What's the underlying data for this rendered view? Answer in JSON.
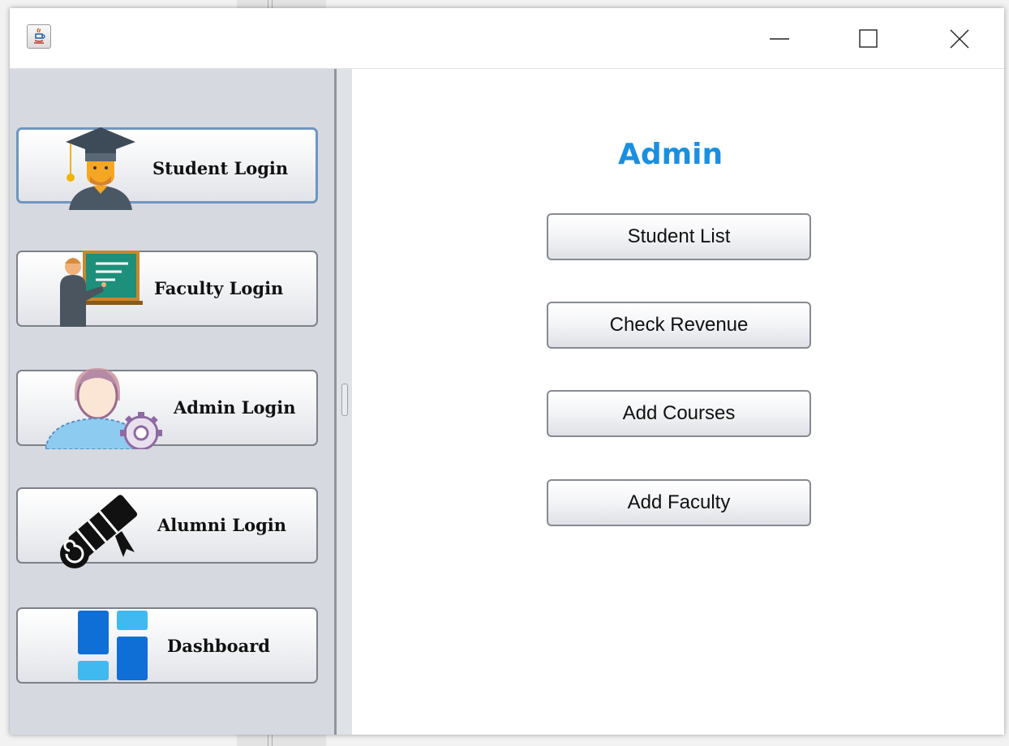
{
  "window": {
    "controls": [
      "minimize",
      "maximize",
      "close"
    ]
  },
  "sidebar": {
    "items": [
      {
        "label": "Student Login",
        "icon": "graduate-student-icon"
      },
      {
        "label": "Faculty Login",
        "icon": "teacher-blackboard-icon"
      },
      {
        "label": "Admin Login",
        "icon": "admin-user-gear-icon"
      },
      {
        "label": "Alumni Login",
        "icon": "diploma-scroll-icon"
      },
      {
        "label": "Dashboard",
        "icon": "dashboard-tiles-icon"
      }
    ]
  },
  "main": {
    "title": "Admin",
    "actions": [
      "Student List",
      "Check Revenue",
      "Add Courses",
      "Add Faculty"
    ]
  },
  "colors": {
    "title": "#1a8fe0",
    "sidebar_bg": "#d6d9df",
    "dashboard_dark": "#0f6fd6",
    "dashboard_light": "#3fb9f0"
  }
}
